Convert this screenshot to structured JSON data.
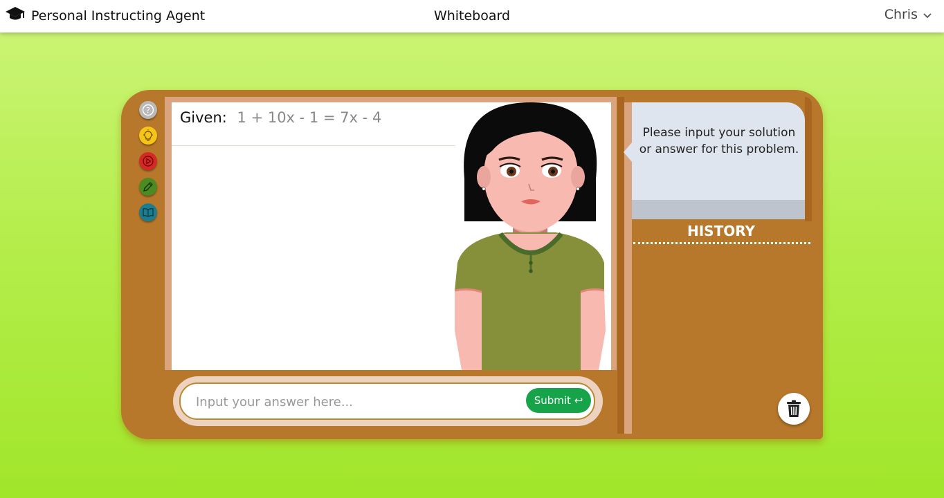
{
  "header": {
    "app_title": "Personal Instructing Agent",
    "page_title": "Whiteboard",
    "user_name": "Chris",
    "logo_icon": "graduation-cap-icon",
    "dropdown_icon": "chevron-down-icon"
  },
  "toolbar": {
    "tools": [
      {
        "name": "help",
        "icon": "question-icon",
        "color": "#b9b9b9"
      },
      {
        "name": "hint",
        "icon": "lightbulb-icon",
        "color": "#f5c518"
      },
      {
        "name": "video",
        "icon": "play-icon",
        "color": "#d42a26"
      },
      {
        "name": "edit",
        "icon": "pencil-icon",
        "color": "#4e8a22"
      },
      {
        "name": "book",
        "icon": "book-icon",
        "color": "#1d7d8e"
      }
    ]
  },
  "whiteboard": {
    "given_label": "Given:",
    "equation": "1 + 10x - 1 = 7x - 4"
  },
  "agent": {
    "message": "Please input your solution or answer for this problem."
  },
  "history": {
    "title": "HISTORY"
  },
  "answer": {
    "placeholder": "Input your answer here...",
    "submit_label": "Submit ↩"
  },
  "colors": {
    "board": "#b8782b",
    "submit": "#16a34a",
    "background_top": "#cdf57a",
    "background_bottom": "#a1e62a"
  }
}
